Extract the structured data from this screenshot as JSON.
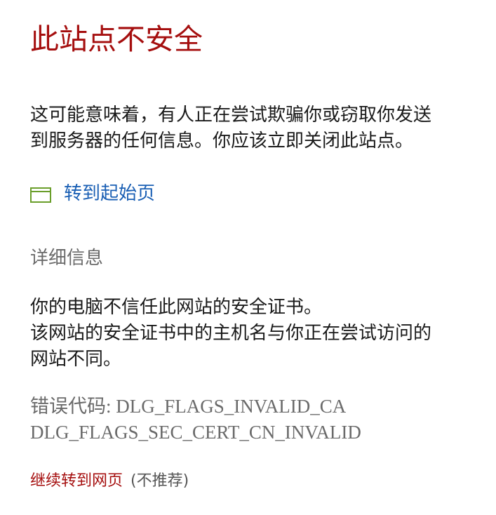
{
  "title": "此站点不安全",
  "message": {
    "line1": "这可能意味着，有人正在尝试欺骗你或窃取你发送",
    "line2": "到服务器的任何信息。你应该立即关闭此站点。"
  },
  "home_link": {
    "icon": "browser-window-icon",
    "label": "转到起始页"
  },
  "details": {
    "heading": "详细信息",
    "line1": "你的电脑不信任此网站的安全证书。",
    "line2": "该网站的安全证书中的主机名与你正在尝试访问的",
    "line3": "网站不同。"
  },
  "error": {
    "label": "错误代码:",
    "code1": "DLG_FLAGS_INVALID_CA",
    "code2": "DLG_FLAGS_SEC_CERT_CN_INVALID"
  },
  "continue": {
    "label": "继续转到网页",
    "note": "(不推荐)"
  },
  "colors": {
    "title": "#a50e0e",
    "link": "#1a5fb4",
    "icon": "#6a9e2a",
    "muted": "#6a6a6a"
  }
}
